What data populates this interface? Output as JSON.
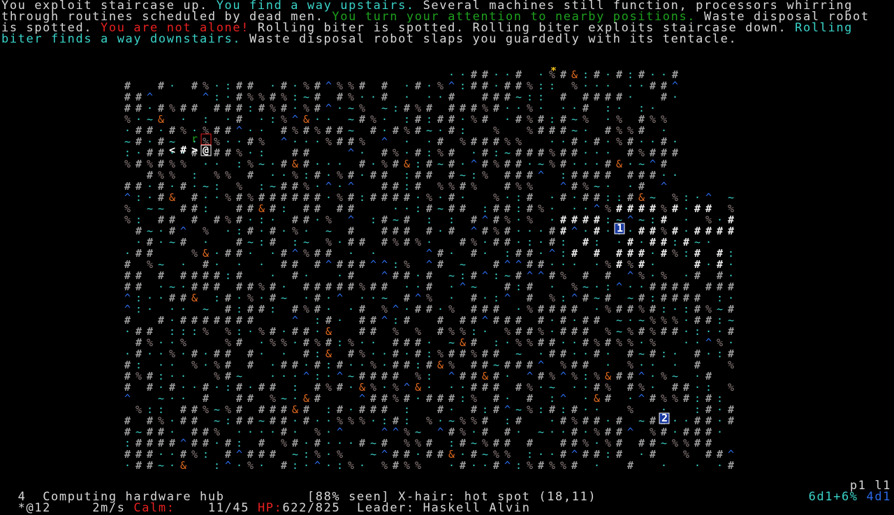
{
  "messages": [
    {
      "text": "You exploit staircase up. ",
      "color": ""
    },
    {
      "text": "You find a way upstairs. ",
      "color": "cyan"
    },
    {
      "text": "Several machines still function, processors whirring through routines scheduled by dead men. ",
      "color": ""
    },
    {
      "text": "You turn your attention to nearby positions. ",
      "color": "green"
    },
    {
      "text": "Waste disposal robot is spotted. ",
      "color": ""
    },
    {
      "text": "You are not alone! ",
      "color": "red"
    },
    {
      "text": "Rolling biter is spotted. Rolling biter exploits staircase down. ",
      "color": ""
    },
    {
      "text": "Rolling biter finds a way downstairs. ",
      "color": "cyan"
    },
    {
      "text": "Waste disposal robot slaps you guardedly with its tentacle.",
      "color": ""
    }
  ],
  "status": {
    "depth": "4",
    "location": "Computing hardware hub",
    "seen": "[88% seen]",
    "xhair": "X-hair: hot spot (18,11)",
    "page": "p1 l1",
    "party_marker": "*@12",
    "speed": "2m/s",
    "calm_label": "Calm:",
    "calm_value": "11/45",
    "hp_label": "HP:",
    "hp_value": "622/825",
    "leader": "Leader: Haskell Alvin",
    "melee": "6d1+6%",
    "dice": "4d1"
  },
  "colors": {
    "wall": "#e8e8e8",
    "wall_dim": "#9a9a9a",
    "rubble": "#8a7a7a",
    "floor": "#3ad3c9",
    "stair_blue": "#2a6ae8",
    "orange": "#e06a20",
    "player_bg": "#ffffff",
    "red": "#e82020"
  }
}
